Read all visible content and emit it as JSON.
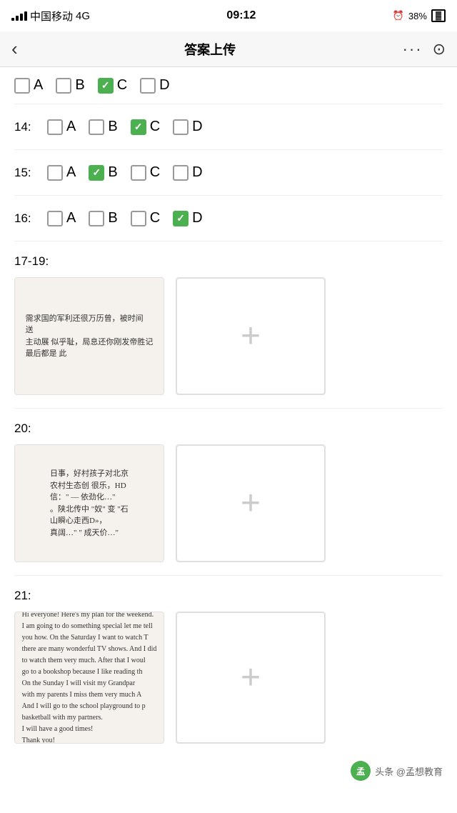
{
  "statusBar": {
    "carrier": "中国移动",
    "network": "4G",
    "time": "09:12",
    "battery": "38%"
  },
  "navBar": {
    "title": "答案上传",
    "backLabel": "‹",
    "moreLabel": "···",
    "cameraLabel": "⊙"
  },
  "partialRow": {
    "label": "",
    "options": [
      {
        "letter": "A",
        "checked": false
      },
      {
        "letter": "B",
        "checked": false
      },
      {
        "letter": "C",
        "checked": true
      },
      {
        "letter": "D",
        "checked": false
      }
    ]
  },
  "questions": [
    {
      "num": "14:",
      "options": [
        {
          "letter": "A",
          "checked": false
        },
        {
          "letter": "B",
          "checked": false
        },
        {
          "letter": "C",
          "checked": true
        },
        {
          "letter": "D",
          "checked": false
        }
      ]
    },
    {
      "num": "15:",
      "options": [
        {
          "letter": "A",
          "checked": false
        },
        {
          "letter": "B",
          "checked": true
        },
        {
          "letter": "C",
          "checked": false
        },
        {
          "letter": "D",
          "checked": false
        }
      ]
    },
    {
      "num": "16:",
      "options": [
        {
          "letter": "A",
          "checked": false
        },
        {
          "letter": "B",
          "checked": false
        },
        {
          "letter": "C",
          "checked": false
        },
        {
          "letter": "D",
          "checked": true
        }
      ]
    }
  ],
  "openSections": [
    {
      "label": "17-19:",
      "image1Type": "handwriting-chinese",
      "image2Type": "add",
      "handwritingLines": [
        "需求国的军利还很万历曾，被时间",
        "送",
        "主动展 似乎耻，局息还你刚发帝胜记",
        "最后都是 此"
      ]
    },
    {
      "label": "20:",
      "image1Type": "handwriting-chinese2",
      "image2Type": "add",
      "handwritingLines": [
        "日事，好村孩子对北京",
        "农村生态创 很乐，HD",
        "信：\" — 依劲化…\"",
        "。陕北传中 \"奴\" 变 \"石",
        "山瞬心走西D»，",
        "真阔…\" \" 成天价…\""
      ]
    },
    {
      "label": "21:",
      "image1Type": "handwriting-english",
      "image2Type": "add",
      "handwritingLines": [
        "Hi everyone! Here's my plan for the weekend.",
        "I am going to do something special let me tell",
        "you how. On the Saturday I want to watch T",
        "there are many wonderful TV shows. And I did",
        "to watch them very much. After that I woul",
        "go to a bookshop because I like reading th",
        "On the Sunday I will visit my Grandpar",
        "with my parents I miss them very much A",
        "And I will go to the school playground to p",
        "basketball with my partners.",
        "I will have a good times!",
        "Thank you!"
      ]
    }
  ],
  "footer": {
    "logoText": "孟",
    "text": "头条 @孟想教育"
  }
}
